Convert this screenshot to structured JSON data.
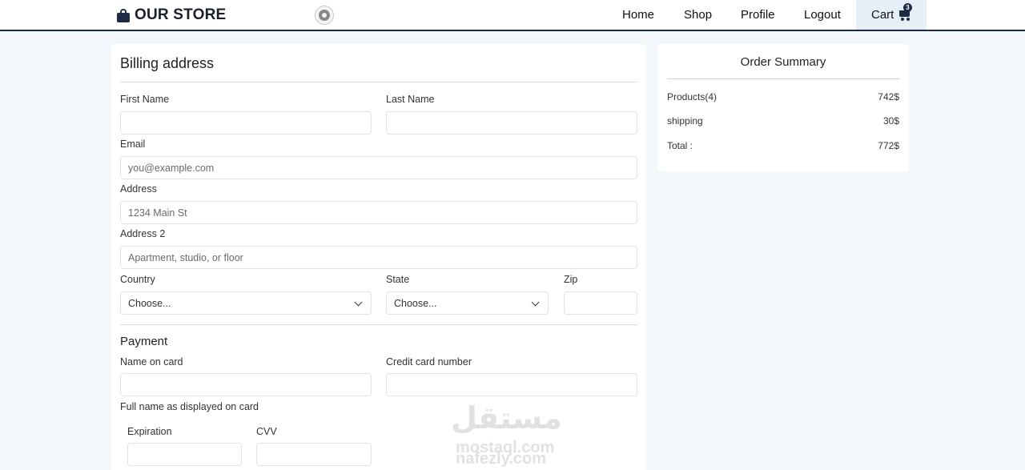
{
  "navbar": {
    "brand": "OUR STORE",
    "links": [
      "Home",
      "Shop",
      "Profile",
      "Logout"
    ],
    "cart_label": "Cart",
    "cart_count": "3",
    "icons": {
      "brand": "shopping-bag-icon",
      "settings": "gear-icon",
      "cart": "shopping-cart-icon"
    },
    "colors": {
      "accent": "#1f2a44",
      "cart_bg": "#e6eef8"
    }
  },
  "billing": {
    "title": "Billing address",
    "first_name_label": "First Name",
    "last_name_label": "Last Name",
    "email_label": "Email",
    "email_placeholder": "you@example.com",
    "address_label": "Address",
    "address_placeholder": "1234 Main St",
    "address2_label": "Address 2",
    "address2_placeholder": "Apartment, studio, or floor",
    "country_label": "Country",
    "country_value": "Choose...",
    "state_label": "State",
    "state_value": "Choose...",
    "zip_label": "Zip"
  },
  "payment": {
    "title": "Payment",
    "name_label": "Name on card",
    "name_hint": "Full name as displayed on card",
    "card_number_label": "Credit card number",
    "expiration_label": "Expiration",
    "cvv_label": "CVV"
  },
  "summary": {
    "title": "Order Summary",
    "rows": [
      {
        "label": "Products(4)",
        "value": "742$"
      },
      {
        "label": "shipping",
        "value": "30$"
      },
      {
        "label": "Total :",
        "value": "772$"
      }
    ]
  },
  "watermark": {
    "line1": "مستقل",
    "line2": "mostaql.com",
    "line3": "nafezly.com"
  }
}
